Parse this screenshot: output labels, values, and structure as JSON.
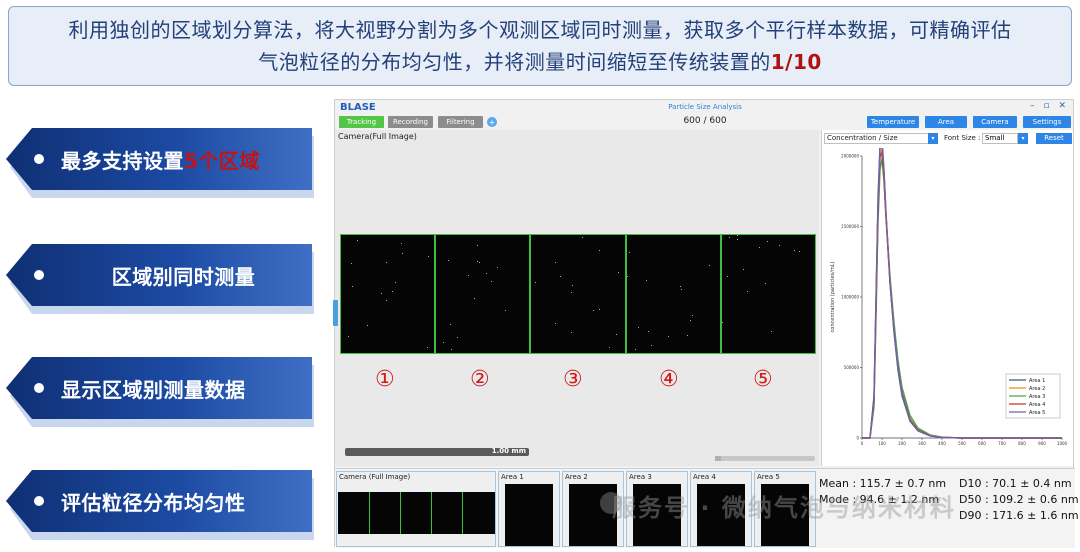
{
  "banner": {
    "line1": "利用独创的区域划分算法，将大视野分割为多个观测区域同时测量，获取多个平行样本数据，可精确评估",
    "line2_pre": "气泡粒径的分布均匀性，并将测量时间缩短至传统装置的",
    "line2_highlight": "1/10"
  },
  "features": [
    {
      "pre": "最多支持设置",
      "highlight": "5个区域",
      "post": ""
    },
    {
      "pre": "区域别同时测量",
      "highlight": "",
      "post": ""
    },
    {
      "pre": "显示区域别测量数据",
      "highlight": "",
      "post": ""
    },
    {
      "pre": "评估粒径分布均匀性",
      "highlight": "",
      "post": ""
    }
  ],
  "app": {
    "brand": "BLASE",
    "title": "Particle Size Analysis",
    "window_controls": "– ▫ ✕",
    "toolbar_left": {
      "tracking": "Tracking",
      "recording": "Recording",
      "filtering": "Filtering",
      "plus": "+"
    },
    "frame_counter": "600  /  600",
    "toolbar_right": {
      "temperature": "Temperature",
      "area": "Area",
      "camera": "Camera",
      "settings": "Settings"
    },
    "camera_label": "Camera(Full Image)",
    "region_numbers": [
      "①",
      "②",
      "③",
      "④",
      "⑤"
    ],
    "scale_bar": "1.00 mm",
    "chart_controls": {
      "plot_select": "Concentration / Size",
      "font_label": "Font Size :",
      "font_select": "Small",
      "reset": "Reset"
    },
    "bottom": {
      "full_label": "Camera (Full Image)",
      "areas": [
        "Area 1",
        "Area 2",
        "Area 3",
        "Area 4",
        "Area 5"
      ]
    },
    "stats": {
      "mean": "Mean : 115.7 ± 0.7 nm",
      "mode": "Mode : 94.6  ± 1.2 nm",
      "d10": "D10 : 70.1   ± 0.4 nm",
      "d50": "D50 : 109.2 ± 0.6 nm",
      "d90": "D90 : 171.6 ± 1.6 nm"
    }
  },
  "watermark": "服务号 · 微纳气泡与纳米材料",
  "chart_data": {
    "type": "line",
    "xlabel": "size (nm)",
    "ylabel": "concentration (particles/mL)",
    "xlim": [
      0,
      1000
    ],
    "ylim": [
      0,
      2000000
    ],
    "x_ticks": [
      0,
      100,
      200,
      300,
      400,
      500,
      600,
      700,
      800,
      900,
      1000
    ],
    "y_ticks": [
      0,
      500000,
      1000000,
      1500000,
      2000000
    ],
    "y_tick_labels": [
      "0",
      "500000",
      "1000000",
      "1500000",
      "2000000"
    ],
    "legend_position": "bottom-right",
    "x": [
      0,
      40,
      60,
      70,
      80,
      90,
      100,
      110,
      120,
      140,
      160,
      180,
      200,
      240,
      280,
      340,
      400,
      500,
      600,
      800,
      1000
    ],
    "series": [
      {
        "name": "Area 1",
        "color": "#2f5b8a",
        "values": [
          0,
          0,
          300000,
          1000000,
          1700000,
          2080000,
          2120000,
          1900000,
          1600000,
          1100000,
          750000,
          480000,
          300000,
          120000,
          50000,
          15000,
          4000,
          0,
          0,
          0,
          0
        ]
      },
      {
        "name": "Area 2",
        "color": "#f28c1e",
        "values": [
          0,
          0,
          250000,
          900000,
          1600000,
          1980000,
          2050000,
          1860000,
          1580000,
          1120000,
          780000,
          510000,
          330000,
          140000,
          60000,
          18000,
          5000,
          0,
          0,
          0,
          0
        ]
      },
      {
        "name": "Area 3",
        "color": "#3fae49",
        "values": [
          0,
          0,
          220000,
          850000,
          1520000,
          1900000,
          1980000,
          1820000,
          1570000,
          1150000,
          820000,
          550000,
          360000,
          160000,
          70000,
          22000,
          6000,
          0,
          0,
          0,
          0
        ]
      },
      {
        "name": "Area 4",
        "color": "#c0392b",
        "values": [
          0,
          0,
          280000,
          950000,
          1650000,
          2000000,
          2020000,
          1830000,
          1560000,
          1100000,
          760000,
          500000,
          320000,
          130000,
          55000,
          17000,
          5000,
          0,
          0,
          0,
          0
        ]
      },
      {
        "name": "Area 5",
        "color": "#7a5fa8",
        "values": [
          0,
          0,
          260000,
          920000,
          1620000,
          2050000,
          2090000,
          1880000,
          1590000,
          1110000,
          770000,
          495000,
          315000,
          125000,
          52000,
          16000,
          4000,
          0,
          0,
          0,
          0
        ]
      }
    ]
  }
}
